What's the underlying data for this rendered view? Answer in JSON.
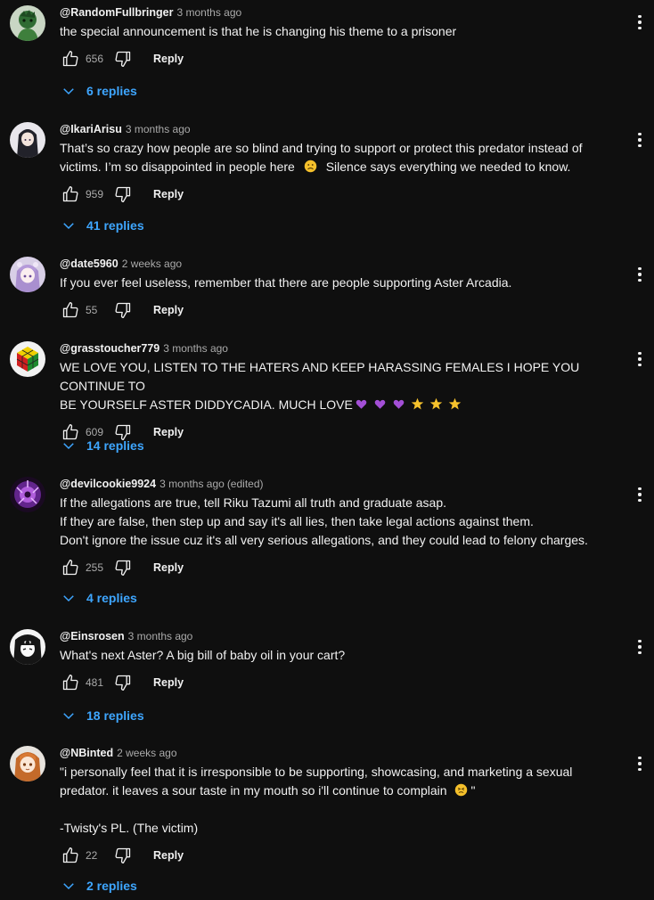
{
  "replies_suffix": "replies",
  "reply_label": "Reply",
  "colors": {
    "background": "#0f0f0f",
    "link": "#3ea6ff",
    "muted": "#aaaaaa",
    "text": "#f1f1f1"
  },
  "comments": [
    {
      "author": "@RandomFullbringer",
      "time": "3 months ago",
      "edited": "",
      "lines": [
        "the special announcement is that he is changing his theme to a prisoner"
      ],
      "likes": "656",
      "replies_text": "6 replies",
      "avatar_icon": "green-character-avatar"
    },
    {
      "author": "@IkariArisu",
      "time": "3 months ago",
      "edited": "",
      "lines": [
        "That’s so crazy how people are so blind and trying to support or protect this predator instead of",
        "victims. I’m so disappointed in people here",
        "Silence says everything we needed to know."
      ],
      "likes": "959",
      "replies_text": "41 replies",
      "avatar_icon": "anime-girl-dark-hair-avatar"
    },
    {
      "author": "@date5960",
      "time": "2 weeks ago",
      "edited": "",
      "lines": [
        "If you ever feel useless, remember that there are people supporting Aster Arcadia."
      ],
      "likes": "55",
      "replies_text": "",
      "avatar_icon": "anime-girl-purple-hair-avatar"
    },
    {
      "author": "@grasstoucher779",
      "time": "3 months ago",
      "edited": "",
      "lines": [
        "WE LOVE YOU, LISTEN TO THE HATERS AND KEEP HARASSING FEMALES I HOPE YOU CONTINUE TO",
        "BE YOURSELF ASTER DIDDYCADIA. MUCH LOVE"
      ],
      "likes": "609",
      "replies_text": "14 replies",
      "avatar_icon": "rubiks-cube-avatar"
    },
    {
      "author": "@devilcookie9924",
      "time": "3 months ago",
      "edited": "(edited)",
      "lines": [
        "If the allegations are true, tell Riku Tazumi all truth and graduate asap.",
        "If they are false, then step up and say it's all lies, then take legal actions against them.",
        "Don't ignore the issue cuz it's all very serious allegations, and they could lead to felony charges."
      ],
      "likes": "255",
      "replies_text": "4 replies",
      "avatar_icon": "purple-glow-avatar"
    },
    {
      "author": "@Einsrosen",
      "time": "3 months ago",
      "edited": "",
      "lines": [
        "What's next Aster? A big bill of baby oil in your cart?"
      ],
      "likes": "481",
      "replies_text": "18 replies",
      "avatar_icon": "monochrome-manga-avatar"
    },
    {
      "author": "@NBinted",
      "time": "2 weeks ago",
      "edited": "",
      "lines": [
        "\"i personally feel that it is irresponsible to be supporting, showcasing, and marketing a sexual",
        "predator. it leaves a sour taste in my mouth so i'll continue to complain",
        "\"",
        "",
        "-Twisty's PL. (The victim)"
      ],
      "likes": "22",
      "replies_text": "2 replies",
      "avatar_icon": "anime-girl-orange-hair-avatar"
    }
  ]
}
